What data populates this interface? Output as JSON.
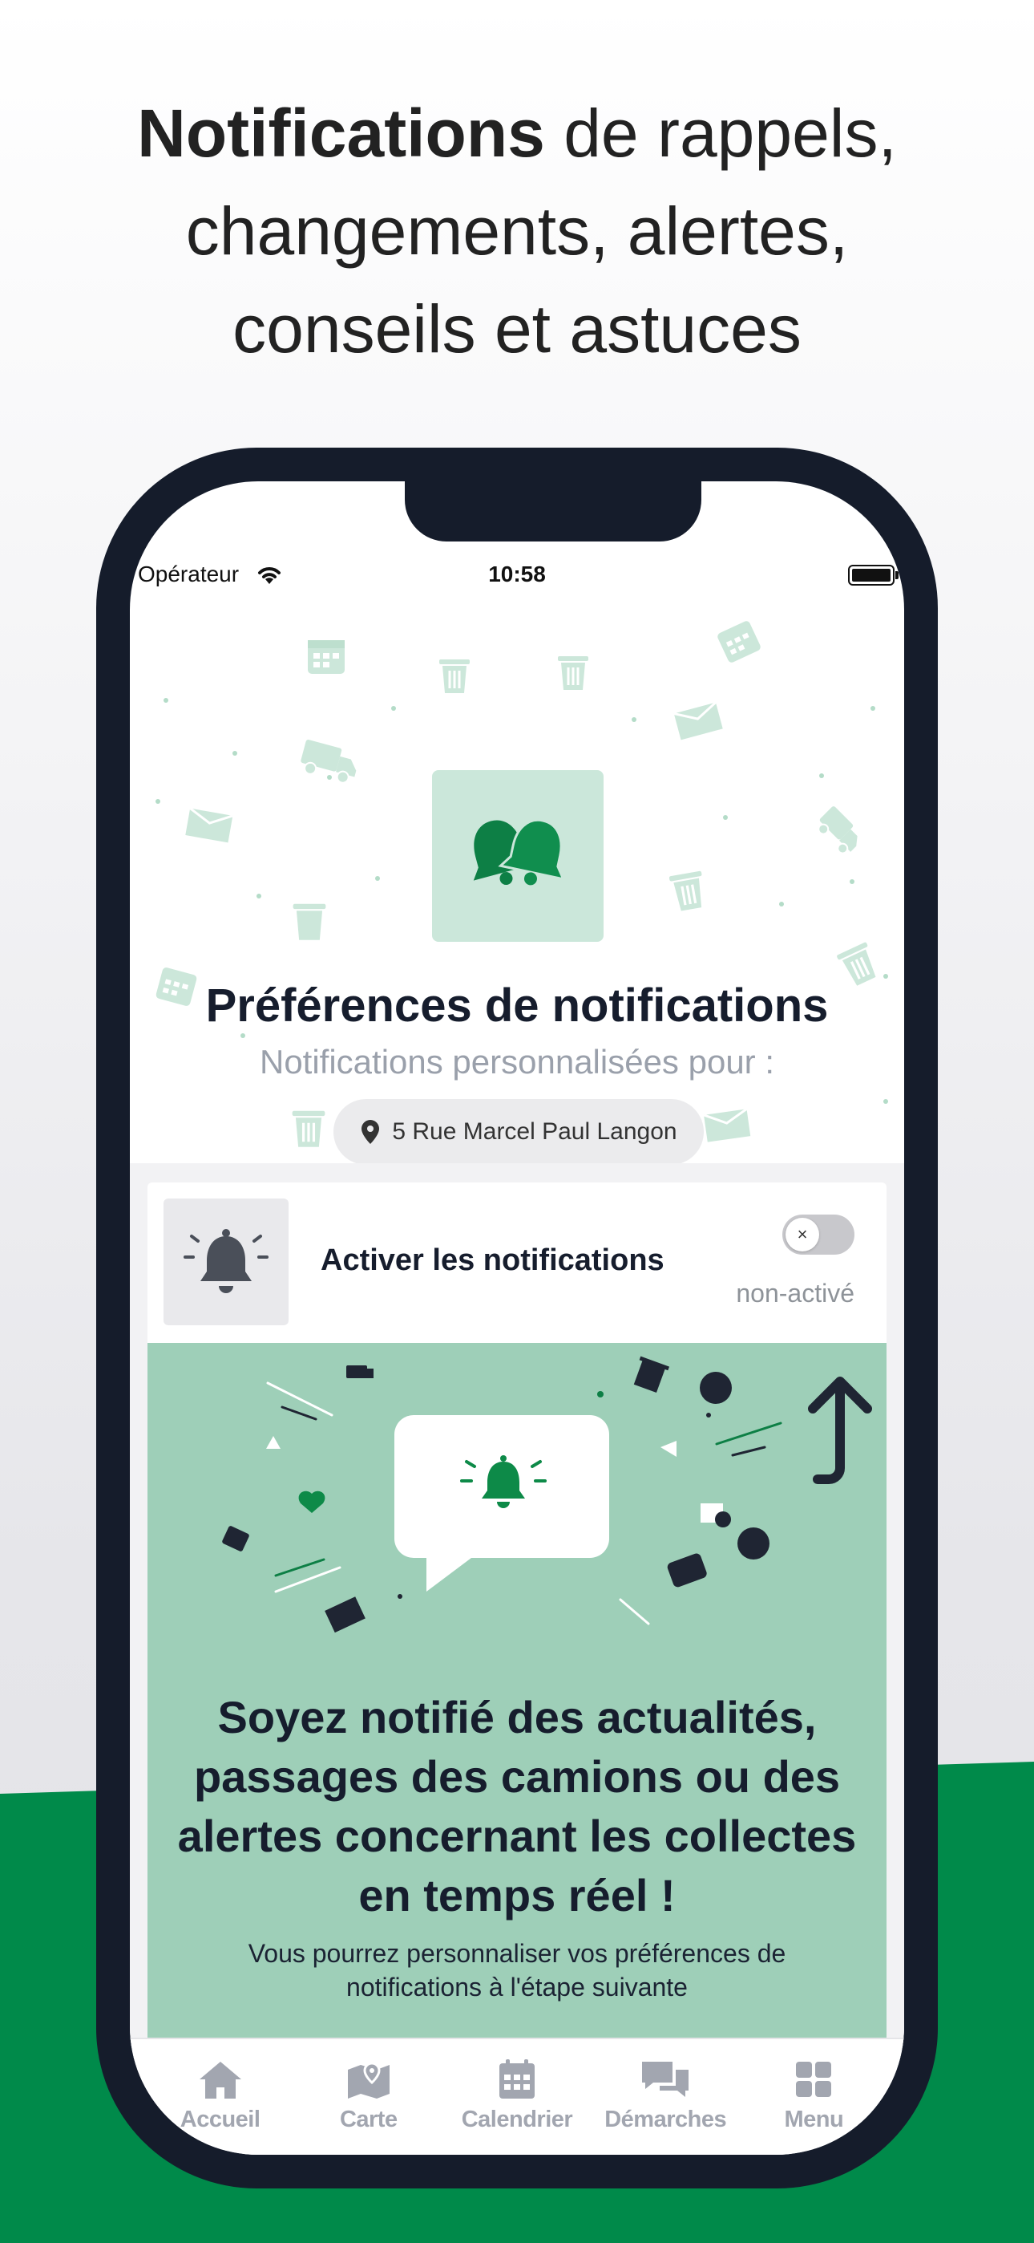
{
  "headline": {
    "bold": "Notifications",
    "rest_line1": " de rappels,",
    "line2": "changements, alertes,",
    "line3": "conseils et astuces"
  },
  "status_bar": {
    "carrier": "Opérateur",
    "time": "10:58"
  },
  "hero": {
    "title": "Préférences de notifications",
    "subtitle": "Notifications personnalisées pour :",
    "address": "5 Rue Marcel Paul  Langon"
  },
  "notification_toggle": {
    "label": "Activer les notifications",
    "state": "non-activé",
    "enabled": false
  },
  "promo": {
    "title": "Soyez notifié des actualités, passages des camions ou des alertes concernant les collectes en temps réel !",
    "text": "Vous pourrez personnaliser vos préférences de notifications à l'étape suivante"
  },
  "tabbar": {
    "items": [
      {
        "label": "Accueil",
        "icon": "home-icon"
      },
      {
        "label": "Carte",
        "icon": "map-icon"
      },
      {
        "label": "Calendrier",
        "icon": "calendar-icon"
      },
      {
        "label": "Démarches",
        "icon": "chat-icon"
      },
      {
        "label": "Menu",
        "icon": "grid-icon"
      }
    ]
  },
  "colors": {
    "brand_green": "#008a4a",
    "dark_navy": "#161d2d",
    "mint": "#9ecfb8",
    "light_mint": "#cbe7da",
    "tab_gray": "#a2a6b0"
  }
}
